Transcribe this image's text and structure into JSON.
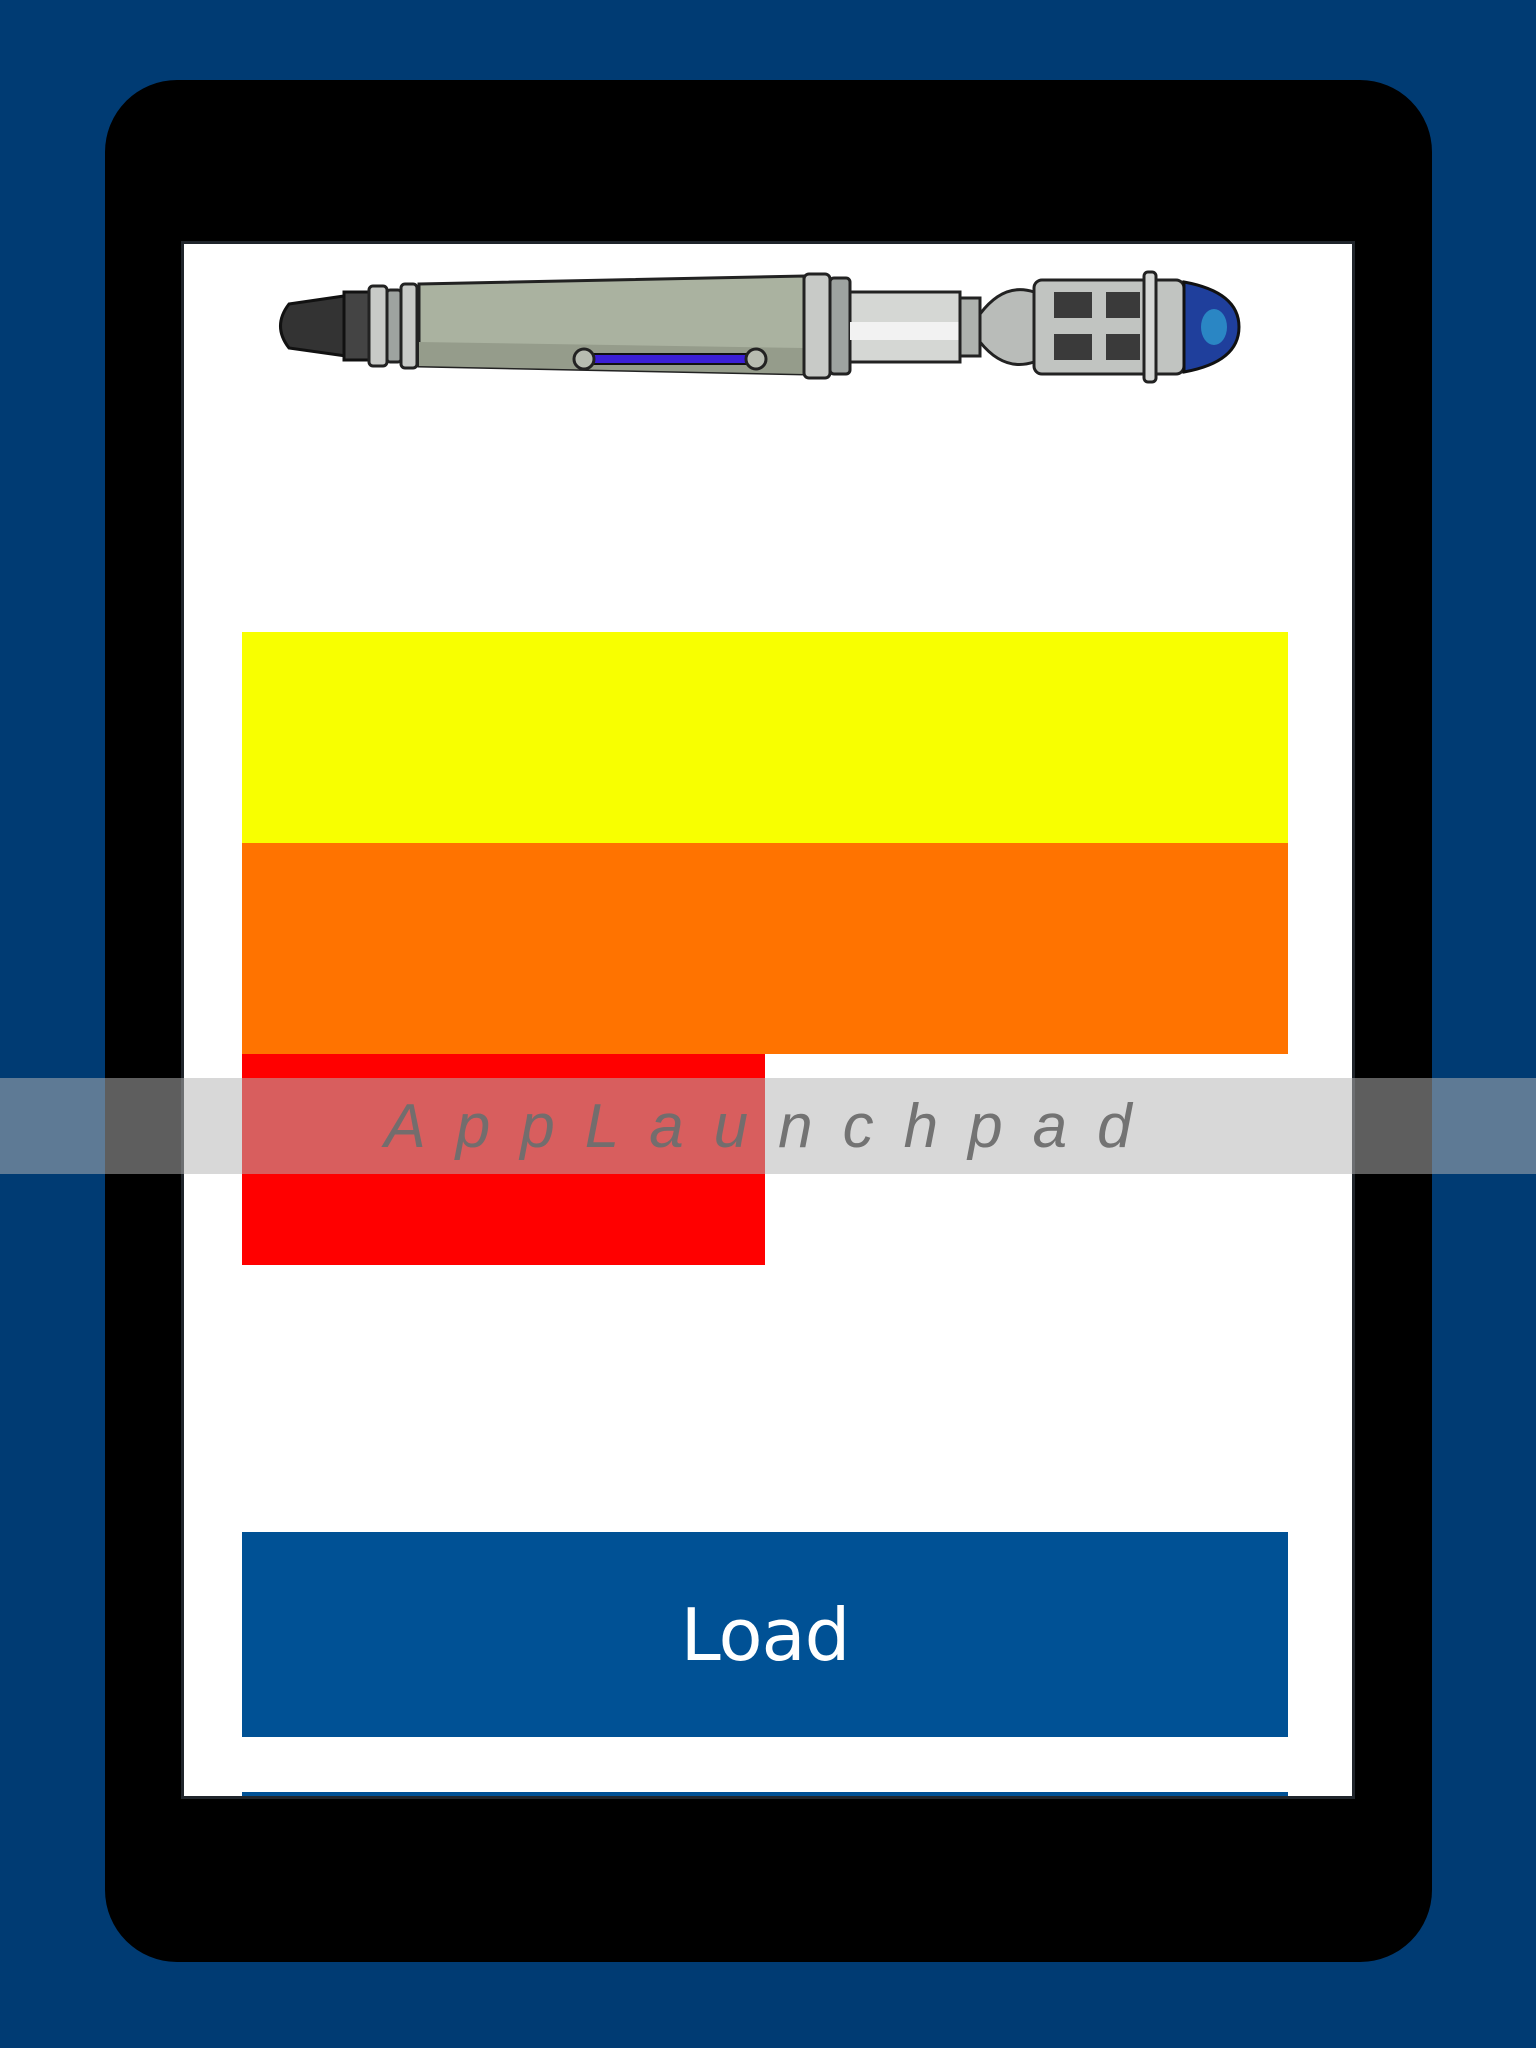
{
  "app": {
    "header_image": "sonic-screwdriver-image"
  },
  "progress_bars": [
    {
      "color": "#f8ff00",
      "fill": 1.0
    },
    {
      "color": "#ff7300",
      "fill": 1.0
    },
    {
      "color": "#ff0000",
      "fill": 0.5
    }
  ],
  "actions": {
    "load_label": "Load"
  },
  "colors": {
    "background": "#003b73",
    "device_frame": "#000000",
    "button": "#005195"
  },
  "watermark": {
    "text": "AppLaunchpad"
  }
}
